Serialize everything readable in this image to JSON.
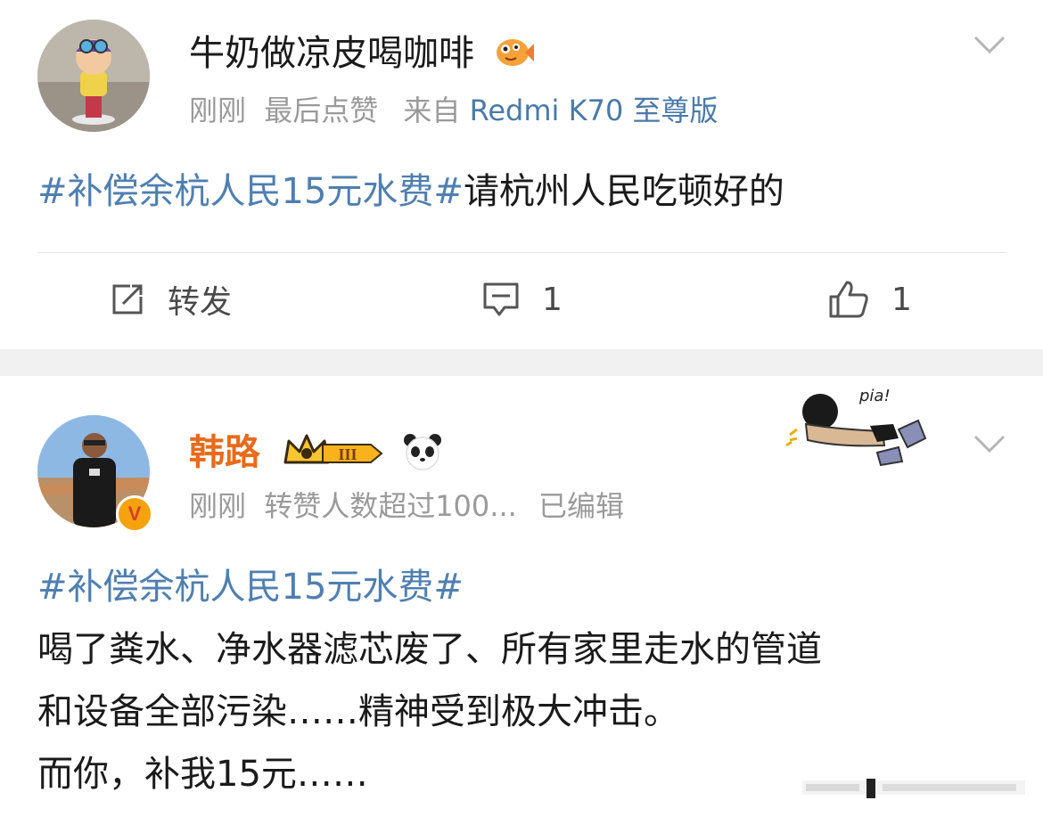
{
  "post1": {
    "username": "牛奶做凉皮喝咖啡",
    "meta_time": "刚刚",
    "meta_action": "最后点赞",
    "meta_from": "来自",
    "meta_device": "Redmi K70 至尊版",
    "topic": "#补偿余杭人民15元水费#",
    "text": "请杭州人民吃顿好的",
    "actions": {
      "repost_label": "转发",
      "comment_count": "1",
      "like_count": "1"
    }
  },
  "post2": {
    "username": "韩路",
    "level_badge": "III",
    "meta_time": "刚刚",
    "meta_stats": "转赞人数超过100...",
    "meta_edited": "已编辑",
    "sticker_text": "pia!",
    "topic": "#补偿余杭人民15元水费#",
    "lines": [
      "喝了粪水、净水器滤芯废了、所有家里走水的管道",
      "和设备全部污染……精神受到极大冲击。",
      "而你，补我15元……"
    ]
  },
  "colors": {
    "link_blue": "#4f7fb0",
    "vip_orange": "#e86a1a",
    "meta_gray": "#9a9a9a"
  }
}
